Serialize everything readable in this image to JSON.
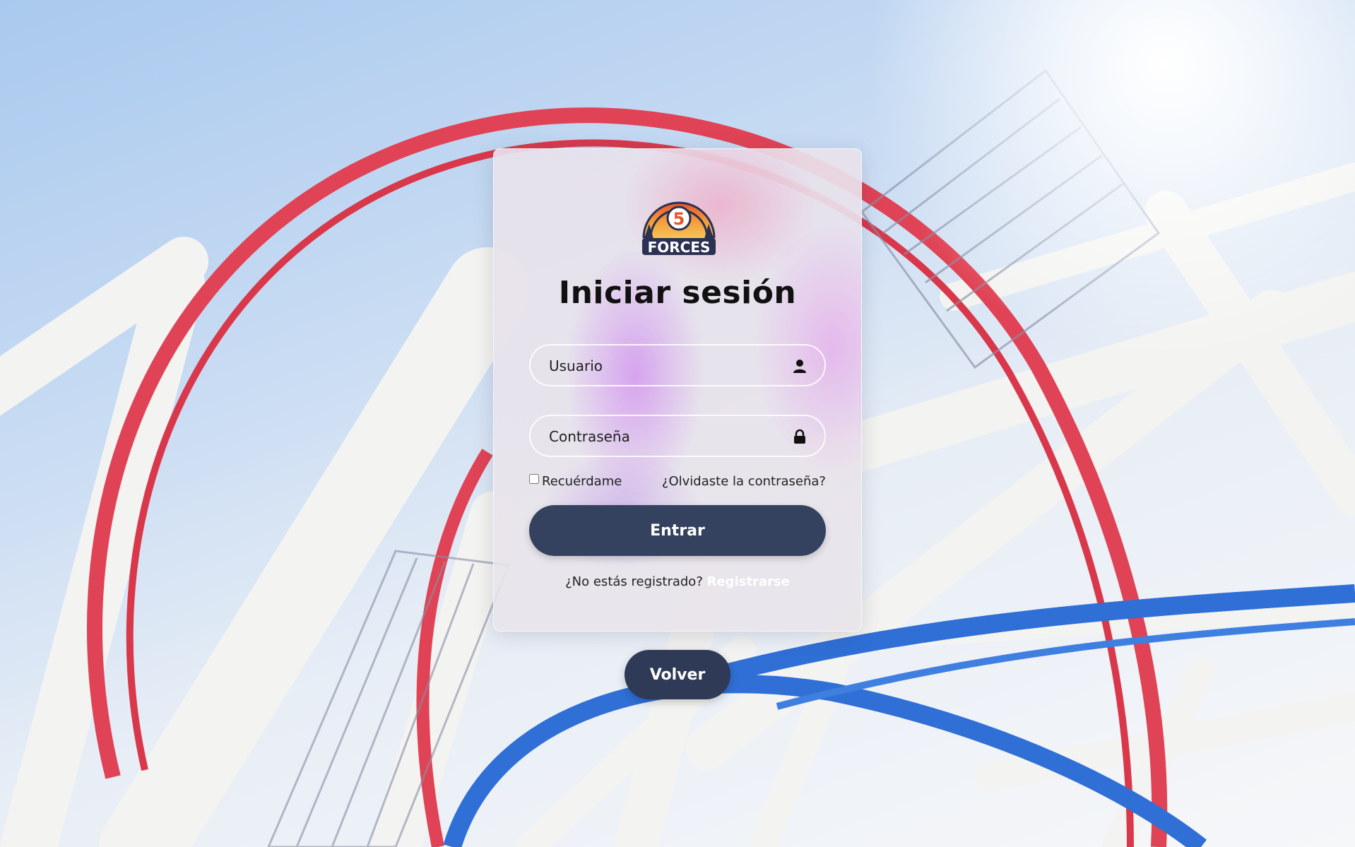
{
  "background": {
    "description_icon": "roller-coaster-photo",
    "colors": {
      "sky": "#b8d2f0",
      "red_track": "#e04355",
      "blue_track": "#2f6fd6",
      "white_support": "#f4f4f2"
    }
  },
  "logo": {
    "icon": "forces-logo",
    "text": "FORCES",
    "number": "5"
  },
  "login": {
    "title": "Iniciar sesión",
    "username_placeholder": "Usuario",
    "password_placeholder": "Contraseña",
    "remember_label": "Recuérdame",
    "forgot_label": "¿Olvidaste la contraseña?",
    "submit_label": "Entrar",
    "not_registered_text": "¿No estás registrado?",
    "register_label": "Registrarse"
  },
  "back_label": "Volver",
  "colors": {
    "primary_button": "#34425f",
    "back_button": "#2e3a56"
  }
}
